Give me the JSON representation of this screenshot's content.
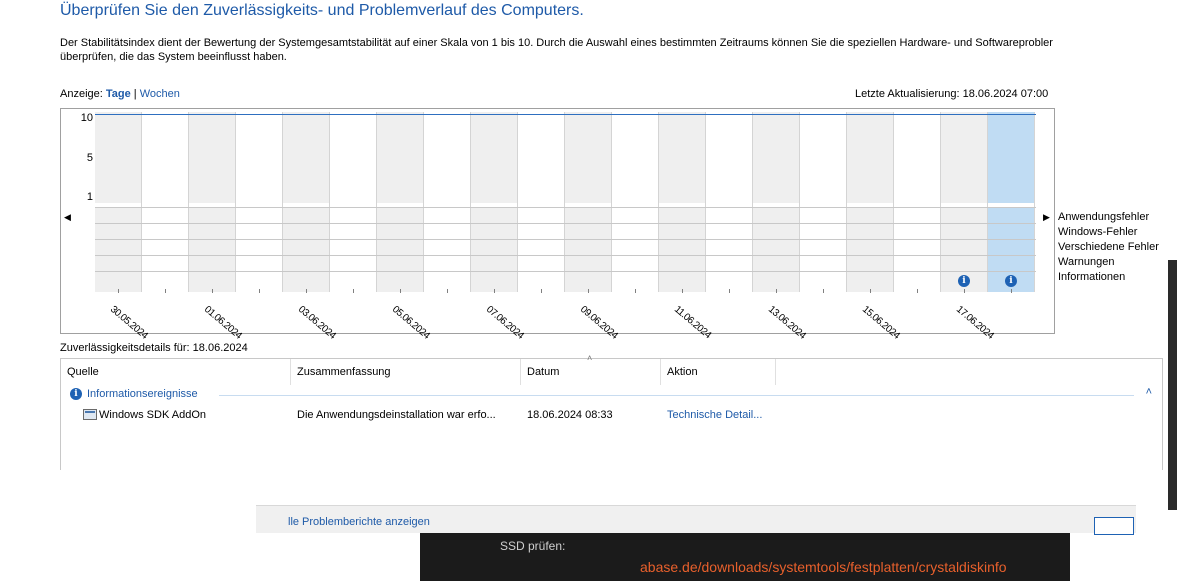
{
  "header": {
    "title": "Überprüfen Sie den Zuverlässigkeits- und Problemverlauf des Computers.",
    "description_line1": "Der Stabilitätsindex dient der Bewertung der Systemgesamtstabilität auf einer Skala von 1 bis 10. Durch die Auswahl eines bestimmten Zeitraums können Sie die speziellen Hardware- und Softwareprobler",
    "description_line2": "überprüfen, die das System beeinflusst haben."
  },
  "view": {
    "label": "Anzeige:",
    "days": "Tage",
    "separator": "|",
    "weeks": "Wochen",
    "last_update": "Letzte Aktualisierung: 18.06.2024 07:00"
  },
  "chart": {
    "y_labels": [
      "10",
      "5",
      "1"
    ],
    "x_labels": [
      "30.05.2024",
      "01.06.2024",
      "03.06.2024",
      "05.06.2024",
      "07.06.2024",
      "09.06.2024",
      "11.06.2024",
      "13.06.2024",
      "15.06.2024",
      "17.06.2024"
    ],
    "legend": [
      "Anwendungsfehler",
      "Windows-Fehler",
      "Verschiedene Fehler",
      "Warnungen",
      "Informationen"
    ],
    "info_icon_glyph": "i",
    "nav_left": "◀",
    "nav_right": "▶"
  },
  "chart_data": {
    "type": "table",
    "days": 20,
    "selected_day": "18.06.2024",
    "stability_index_max": 10,
    "informational_events_on": [
      "17.06.2024",
      "18.06.2024"
    ]
  },
  "details": {
    "label": "Zuverlässigkeitsdetails für: 18.06.2024",
    "columns": [
      "Quelle",
      "Zusammenfassung",
      "Datum",
      "Aktion"
    ],
    "group_label": "Informationsereignisse",
    "collapse_glyph": "˄",
    "rows": [
      {
        "source": "Windows SDK AddOn",
        "summary": "Die Anwendungsdeinstallation war erfo...",
        "date": "18.06.2024 08:33",
        "action": "Technische Detail..."
      }
    ]
  },
  "footer": {
    "link": "lle Problemberichte anzeigen",
    "dark_text": "SSD prüfen:",
    "dark_link": "abase.de/downloads/systemtools/festplatten/crystaldiskinfo"
  },
  "colors": {
    "accent": "#1e5aa8",
    "selected_column": "#c0dcf3",
    "shaded_column": "#efefef",
    "info_icon": "#1e62b4",
    "dark_link": "#e8602c"
  }
}
